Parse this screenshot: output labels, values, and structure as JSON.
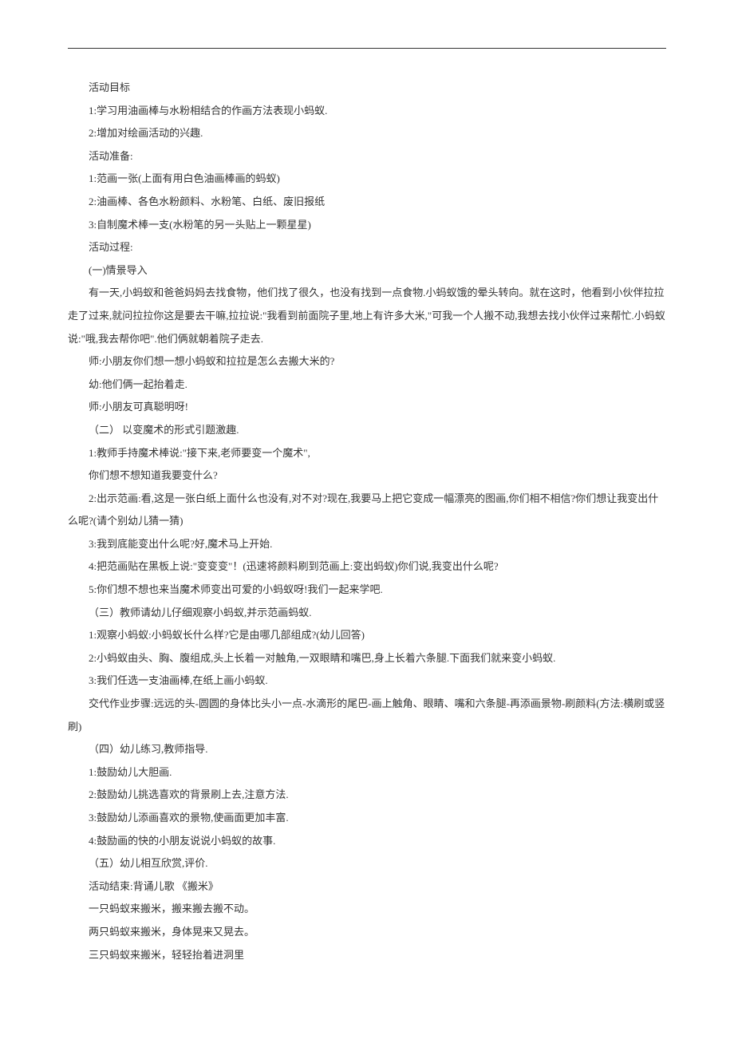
{
  "lines": [
    "活动目标",
    "1:学习用油画棒与水粉相结合的作画方法表现小蚂蚁.",
    "2:增加对绘画活动的兴趣.",
    "活动准备:",
    "1:范画一张(上面有用白色油画棒画的蚂蚁)",
    "2:油画棒、各色水粉颜料、水粉笔、白纸、废旧报纸",
    "3:自制魔术棒一支(水粉笔的另一头贴上一颗星星)",
    "活动过程:",
    "(一)情景导入",
    "有一天,小蚂蚁和爸爸妈妈去找食物，他们找了很久，也没有找到一点食物.小蚂蚁饿的晕头转向。就在这时，他看到小伙伴拉拉走了过来,就问拉拉你这是要去干嘛,拉拉说:\"我看到前面院子里,地上有许多大米,\"可我一个人搬不动,我想去找小伙伴过来帮忙.小蚂蚁说:\"哦,我去帮你吧\".他们俩就朝着院子走去.",
    "师:小朋友你们想一想小蚂蚁和拉拉是怎么去搬大米的?",
    "幼:他们俩一起抬着走.",
    "师:小朋友可真聪明呀!",
    "（二） 以变魔术的形式引题激趣.",
    "1:教师手持魔术棒说:\"接下来,老师要变一个魔术\",",
    "你们想不想知道我要变什么?",
    "2:出示范画:看,这是一张白纸上面什么也没有,对不对?现在,我要马上把它变成一幅漂亮的图画,你们相不相信?你们想让我变出什么呢?(请个别幼儿猜一猜)",
    "3:我到底能变出什么呢?好,魔术马上开始.",
    "4:把范画贴在黑板上说:\"变变变\"！(迅速将颜料刷到范画上:变出蚂蚁)你们说,我变出什么呢?",
    "5:你们想不想也来当魔术师变出可爱的小蚂蚁呀!我们一起来学吧.",
    "（三）教师请幼儿仔细观察小蚂蚁,并示范画蚂蚁.",
    "1:观察小蚂蚁:小蚂蚁长什么样?它是由哪几部组成?(幼儿回答)",
    "2:小蚂蚁由头、胸、腹组成,头上长着一对触角,一双眼睛和嘴巴,身上长着六条腿.下面我们就来变小蚂蚁.",
    "3:我们任选一支油画棒,在纸上画小蚂蚁.",
    "交代作业步骤:远远的头-圆圆的身体比头小一点-水滴形的尾巴-画上触角、眼睛、嘴和六条腿-再添画景物-刷颜料(方法:横刷或竖刷)",
    "（四）幼儿练习,教师指导.",
    "1:鼓励幼儿大胆画.",
    "2:鼓励幼儿挑选喜欢的背景刷上去,注意方法.",
    "3:鼓励幼儿添画喜欢的景物,使画面更加丰富.",
    "4:鼓励画的快的小朋友说说小蚂蚁的故事.",
    "（五）幼儿相互欣赏,评价.",
    "活动结束:背诵儿歌       《搬米》",
    "一只蚂蚁来搬米，搬来搬去搬不动。",
    "两只蚂蚁来搬米，身体晃来又晃去。",
    "三只蚂蚁来搬米，轻轻抬着进洞里"
  ]
}
